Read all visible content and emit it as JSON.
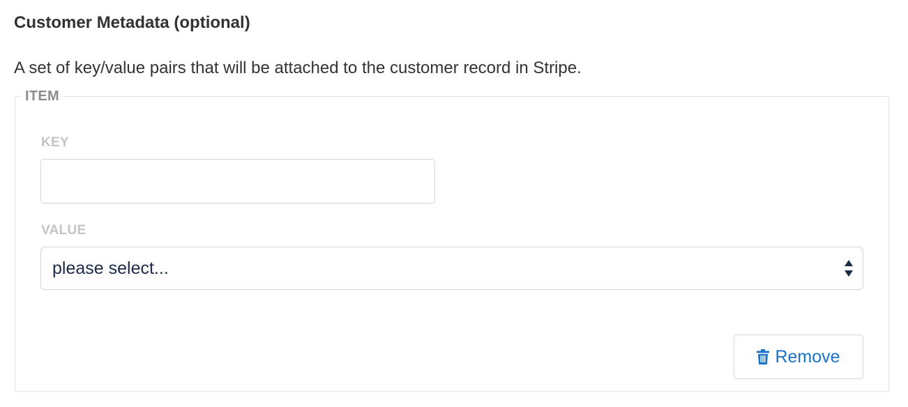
{
  "section": {
    "title": "Customer Metadata (optional)",
    "description": "A set of key/value pairs that will be attached to the customer record in Stripe."
  },
  "item": {
    "legend": "ITEM",
    "key": {
      "label": "KEY",
      "value": ""
    },
    "value": {
      "label": "VALUE",
      "selected": "please select...",
      "icon": "select-updown-icon"
    },
    "remove": {
      "label": "Remove",
      "icon": "trash-icon"
    }
  },
  "colors": {
    "accent": "#1a73c8",
    "select_text": "#1c2a4a",
    "label_muted": "#c4c4c4",
    "legend": "#8c8c8c",
    "border": "#d3d6db"
  }
}
